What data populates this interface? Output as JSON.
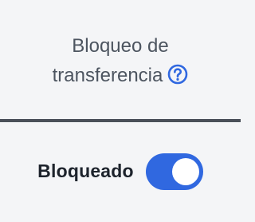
{
  "header": {
    "line1": "Bloqueo de",
    "line2": "transferencia",
    "help_icon": "question-circle-icon"
  },
  "setting": {
    "label": "Bloqueado",
    "toggle_on": true
  },
  "colors": {
    "accent": "#3068e0",
    "header_text": "#4d5560",
    "label_text": "#1d232c",
    "divider": "#4a5059",
    "background": "#f4f5f7"
  }
}
